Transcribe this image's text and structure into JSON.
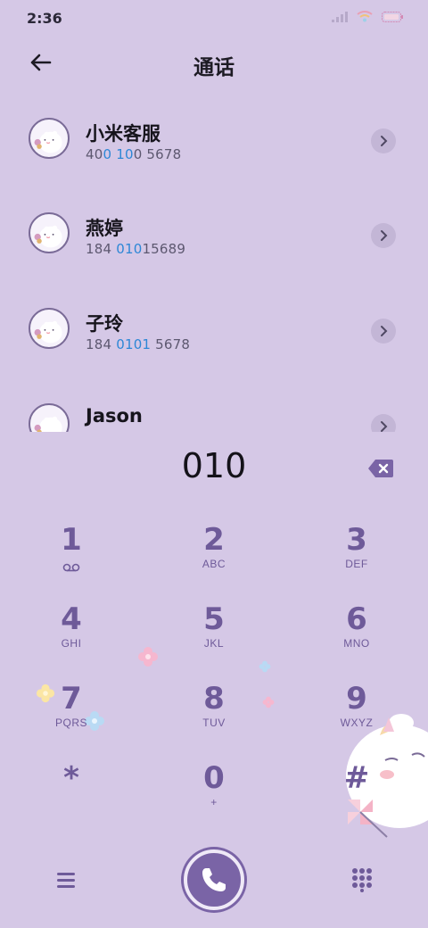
{
  "status_bar": {
    "time": "2:36"
  },
  "header": {
    "title": "通话"
  },
  "contacts": [
    {
      "name": "小米客服",
      "number_parts": [
        "40",
        "0 10",
        "0 5678"
      ]
    },
    {
      "name": "燕婷",
      "number_parts": [
        "184 ",
        "010",
        "15689"
      ]
    },
    {
      "name": "子玲",
      "number_parts": [
        "184 ",
        "0101",
        " 5678"
      ]
    },
    {
      "name": "Jason",
      "number_parts": [
        "",
        "",
        ""
      ]
    }
  ],
  "dial": {
    "input": "010"
  },
  "keys": [
    {
      "digit": "1",
      "letters": ""
    },
    {
      "digit": "2",
      "letters": "ABC"
    },
    {
      "digit": "3",
      "letters": "DEF"
    },
    {
      "digit": "4",
      "letters": "GHI"
    },
    {
      "digit": "5",
      "letters": "JKL"
    },
    {
      "digit": "6",
      "letters": "MNO"
    },
    {
      "digit": "7",
      "letters": "PQRS"
    },
    {
      "digit": "8",
      "letters": "TUV"
    },
    {
      "digit": "9",
      "letters": "WXYZ"
    },
    {
      "digit": "*",
      "letters": ""
    },
    {
      "digit": "0",
      "letters": "+"
    },
    {
      "digit": "#",
      "letters": ""
    }
  ],
  "colors": {
    "background": "#d5c8e6",
    "accent": "#6e5a99",
    "highlight": "#2d87d6"
  },
  "icons": {
    "back": "arrow-left-icon",
    "backspace": "backspace-icon",
    "menu": "menu-icon",
    "call": "phone-icon",
    "dialpad": "dialpad-icon",
    "voicemail": "voicemail-icon"
  }
}
